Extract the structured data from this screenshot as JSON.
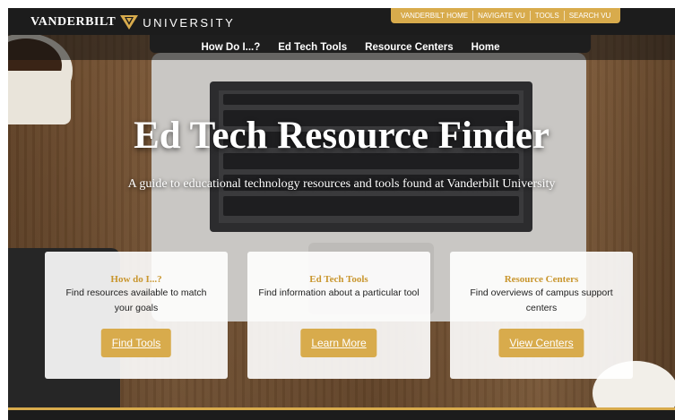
{
  "brand": {
    "word1": "VANDERBILT",
    "word2": "UNIVERSITY",
    "logo_icon": "vanderbilt-v-oak-leaf-logo",
    "accent_color": "#d8ab4c"
  },
  "utility_nav": [
    {
      "label": "VANDERBILT HOME"
    },
    {
      "label": "NAVIGATE VU"
    },
    {
      "label": "TOOLS"
    },
    {
      "label": "SEARCH VU"
    }
  ],
  "main_nav": [
    {
      "label": "How Do I...?"
    },
    {
      "label": "Ed Tech Tools"
    },
    {
      "label": "Resource Centers"
    },
    {
      "label": "Home"
    }
  ],
  "hero": {
    "title": "Ed Tech Resource Finder",
    "subtitle": "A guide to educational technology resources and tools found at Vanderbilt University"
  },
  "cards": [
    {
      "title": "How do I...?",
      "description": "Find resources available to match your goals",
      "button": "Find Tools"
    },
    {
      "title": "Ed Tech Tools",
      "description": "Find information about a particular tool",
      "button": "Learn More"
    },
    {
      "title": "Resource Centers",
      "description": "Find overviews of campus support centers",
      "button": "View Centers"
    }
  ]
}
